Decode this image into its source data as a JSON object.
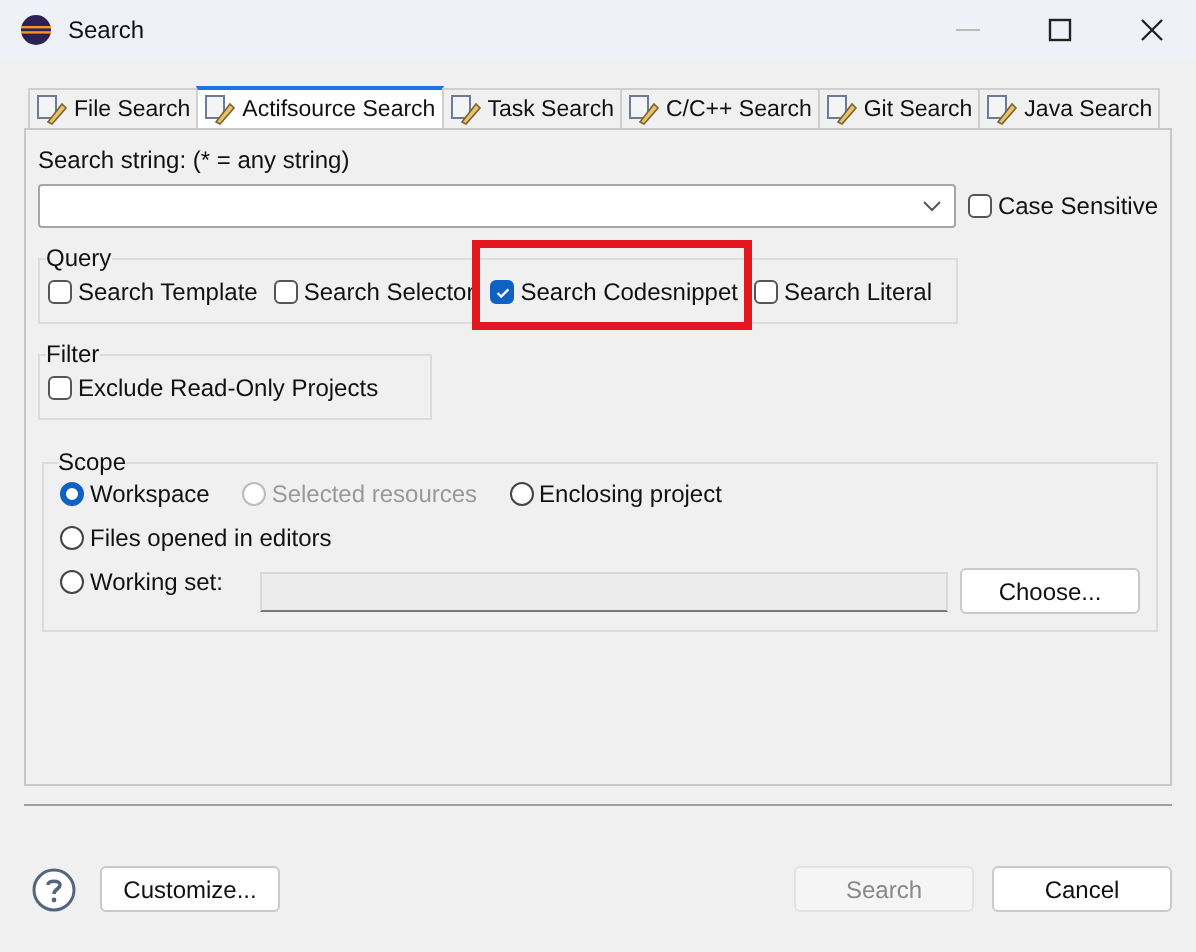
{
  "window": {
    "title": "Search"
  },
  "tabs": [
    {
      "label": "File Search",
      "selected": false
    },
    {
      "label": "Actifsource Search",
      "selected": true
    },
    {
      "label": "Task Search",
      "selected": false
    },
    {
      "label": "C/C++ Search",
      "selected": false
    },
    {
      "label": "Git Search",
      "selected": false
    },
    {
      "label": "Java Search",
      "selected": false
    }
  ],
  "search_string": {
    "label": "Search string: (* = any string)",
    "case_sensitive": {
      "label": "Case Sensitive",
      "checked": false
    }
  },
  "query": {
    "title": "Query",
    "options": [
      {
        "label": "Search Template",
        "checked": false,
        "highlighted": false
      },
      {
        "label": "Search Selector",
        "checked": false,
        "highlighted": false
      },
      {
        "label": "Search Codesnippet",
        "checked": true,
        "highlighted": true
      },
      {
        "label": "Search Literal",
        "checked": false,
        "highlighted": false
      }
    ]
  },
  "filter": {
    "title": "Filter",
    "options": [
      {
        "label": "Exclude Read-Only Projects",
        "checked": false
      }
    ]
  },
  "scope": {
    "title": "Scope",
    "options": [
      {
        "label": "Workspace",
        "selected": true,
        "disabled": false
      },
      {
        "label": "Selected resources",
        "selected": false,
        "disabled": true
      },
      {
        "label": "Enclosing project",
        "selected": false,
        "disabled": false
      },
      {
        "label": "Files opened in editors",
        "selected": false,
        "disabled": false
      },
      {
        "label": "Working set:",
        "selected": false,
        "disabled": false
      }
    ],
    "choose_button": "Choose..."
  },
  "buttons": {
    "customize": "Customize...",
    "search": {
      "label": "Search",
      "disabled": true
    },
    "cancel": "Cancel"
  }
}
